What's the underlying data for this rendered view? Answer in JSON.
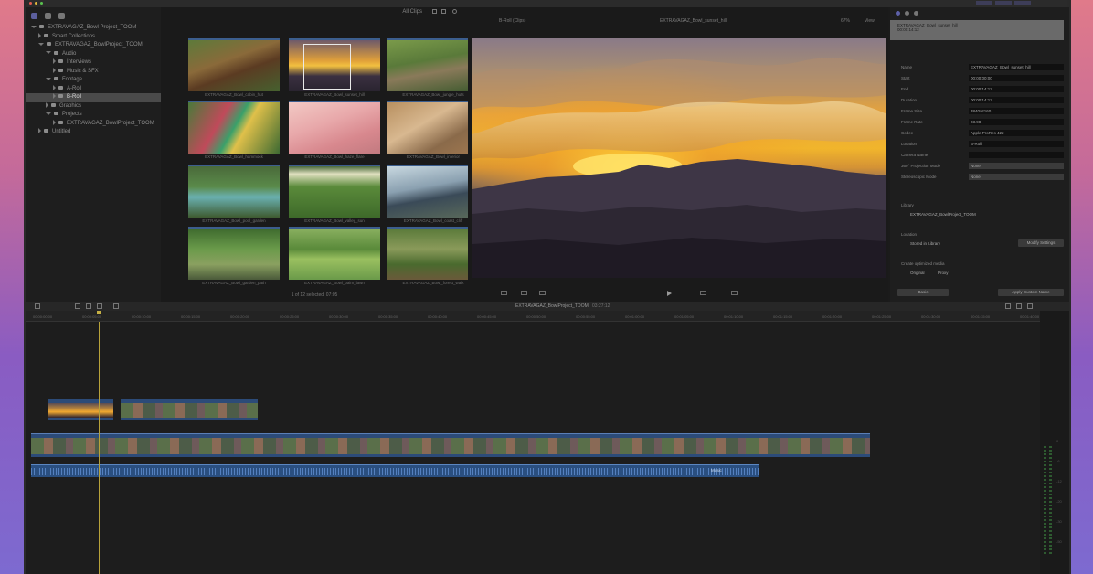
{
  "app": {
    "accent": "#5c5f9e",
    "clip_color": "#2c4b78",
    "playhead_color": "#b8a23a"
  },
  "libraries": {
    "items": [
      {
        "label": "EXTRAVAGAZ_Bowl Project_TOOM",
        "depth": 0,
        "selected": false,
        "expanded": true
      },
      {
        "label": "Smart Collections",
        "depth": 1,
        "selected": false,
        "expanded": false
      },
      {
        "label": "EXTRAVAGAZ_BowlProject_TOOM",
        "depth": 1,
        "selected": false,
        "expanded": true
      },
      {
        "label": "Audio",
        "depth": 2,
        "selected": false,
        "expanded": true
      },
      {
        "label": "Interviews",
        "depth": 3,
        "selected": false,
        "expanded": false
      },
      {
        "label": "Music & SFX",
        "depth": 3,
        "selected": false,
        "expanded": false
      },
      {
        "label": "Footage",
        "depth": 2,
        "selected": false,
        "expanded": true
      },
      {
        "label": "A-Roll",
        "depth": 3,
        "selected": false,
        "expanded": false
      },
      {
        "label": "B-Roll",
        "depth": 3,
        "selected": true,
        "expanded": false
      },
      {
        "label": "Graphics",
        "depth": 2,
        "selected": false,
        "expanded": false
      },
      {
        "label": "Projects",
        "depth": 2,
        "selected": false,
        "expanded": true
      },
      {
        "label": "EXTRAVAGAZ_BowlProject_TOOM",
        "depth": 3,
        "selected": false,
        "expanded": false
      },
      {
        "label": "Untitled",
        "depth": 1,
        "selected": false,
        "expanded": false
      }
    ]
  },
  "browser": {
    "filter_label": "All Clips",
    "footer": "1 of 12 selected, 07:05",
    "clips": [
      {
        "name": "EXTRAVAGAZ_Bowl_cabin_hut",
        "palette": "cabin"
      },
      {
        "name": "EXTRAVAGAZ_Bowl_sunset_hill",
        "palette": "sunset"
      },
      {
        "name": "EXTRAVAGAZ_Bowl_jungle_huts",
        "palette": "huts"
      },
      {
        "name": "EXTRAVAGAZ_Bowl_hammock",
        "palette": "hammock"
      },
      {
        "name": "EXTRAVAGAZ_Bowl_haze_flare",
        "palette": "haze"
      },
      {
        "name": "EXTRAVAGAZ_Bowl_interior",
        "palette": "interior"
      },
      {
        "name": "EXTRAVAGAZ_Bowl_pool_garden",
        "palette": "pool"
      },
      {
        "name": "EXTRAVAGAZ_Bowl_valley_sun",
        "palette": "valley"
      },
      {
        "name": "EXTRAVAGAZ_Bowl_coast_cliff",
        "palette": "coast"
      },
      {
        "name": "EXTRAVAGAZ_Bowl_garden_path",
        "palette": "garden"
      },
      {
        "name": "EXTRAVAGAZ_Bowl_palm_lawn",
        "palette": "lawn"
      },
      {
        "name": "EXTRAVAGAZ_Bowl_forest_walk",
        "palette": "forest"
      }
    ]
  },
  "viewer": {
    "title": "B-Roll (Clips)",
    "clip_name": "EXTRAVAGAZ_Bowl_sunset_hill",
    "zoom": "67%",
    "view_label": "View"
  },
  "inspector": {
    "header_line1": "EXTRAVAGAZ_Bowl_sunset_hill",
    "header_line2": "00:00:14:12",
    "rows": [
      {
        "key": "Name",
        "value": "EXTRAVAGAZ_Bowl_sunset_hill"
      },
      {
        "key": "Start",
        "value": "00:00:00:00"
      },
      {
        "key": "End",
        "value": "00:00:14:12"
      },
      {
        "key": "Duration",
        "value": "00:00:14:12"
      },
      {
        "key": "Frame Size",
        "value": "3840x2160"
      },
      {
        "key": "Frame Rate",
        "value": "23.98"
      },
      {
        "key": "Codec",
        "value": "Apple ProRes 422"
      },
      {
        "key": "Location",
        "value": "B-Roll"
      },
      {
        "key": "Camera Name",
        "value": ""
      },
      {
        "key": "360° Projection Mode",
        "value": "None"
      },
      {
        "key": "Stereoscopic Mode",
        "value": "None"
      }
    ],
    "section_library": "Library",
    "library_value": "EXTRAVAGAZ_BowlProject_TOOM",
    "section_storage": "Location",
    "storage_value": "Stored in Library",
    "storage_button": "Modify Settings",
    "section_media": "Create optimized media",
    "media_options": [
      "Original",
      "Proxy"
    ],
    "bottom_left_button": "Basic",
    "bottom_right_button": "Apply Custom Name"
  },
  "timeline": {
    "project_name": "EXTRAVAGAZ_BowlProject_TOOM",
    "duration": "03:27:12",
    "ruler_ticks": [
      "00:00:00:00",
      "00:00:05:00",
      "00:00:10:00",
      "00:00:15:00",
      "00:00:20:00",
      "00:00:25:00",
      "00:00:30:00",
      "00:00:35:00",
      "00:00:40:00",
      "00:00:45:00",
      "00:00:50:00",
      "00:00:55:00",
      "00:01:00:00",
      "00:01:05:00",
      "00:01:10:00",
      "00:01:15:00",
      "00:01:20:00",
      "00:01:25:00",
      "00:01:30:00",
      "00:01:35:00",
      "00:01:40:00"
    ],
    "audio_label": "Music",
    "meter_labels": [
      "0",
      "-6",
      "-12",
      "-20",
      "-30",
      "-50"
    ]
  }
}
